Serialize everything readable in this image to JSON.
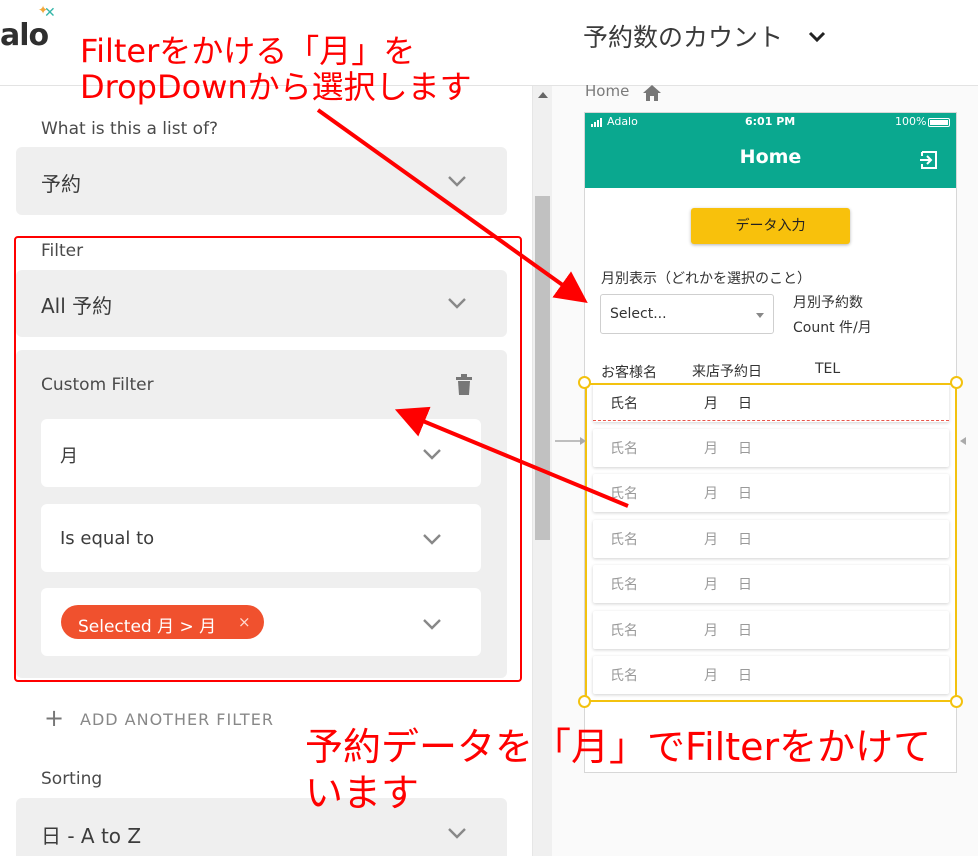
{
  "header": {
    "logo_text": "alo",
    "screen_title": "予約数のカウント"
  },
  "left_panel": {
    "list_of_label": "What is this a list of?",
    "list_of_value": "予約",
    "filter_label": "Filter",
    "filter_value": "All 予約",
    "custom_filter_label": "Custom Filter",
    "field_value": "月",
    "operator_value": "Is equal to",
    "chip_label": "Selected 月 > 月",
    "chip_close": "×",
    "add_filter_label": "ADD ANOTHER FILTER",
    "add_filter_plus": "+",
    "sorting_label": "Sorting",
    "sorting_value": "日 - A to Z"
  },
  "canvas": {
    "breadcrumb": "Home"
  },
  "phone": {
    "status_carrier": "Adalo",
    "status_time": "6:01 PM",
    "status_battery": "100%",
    "title": "Home",
    "data_button": "データ入力",
    "monthly_label": "月別表示（どれかを選択のこと）",
    "dropdown_placeholder": "Select...",
    "count_label_1": "月別予約数",
    "count_label_2": "Count 件/月",
    "columns": [
      "お客様名",
      "来店予約日",
      "TEL"
    ],
    "rows": [
      {
        "name": "氏名",
        "month": "月",
        "day": "日"
      },
      {
        "name": "氏名",
        "month": "月",
        "day": "日"
      },
      {
        "name": "氏名",
        "month": "月",
        "day": "日"
      },
      {
        "name": "氏名",
        "month": "月",
        "day": "日"
      },
      {
        "name": "氏名",
        "month": "月",
        "day": "日"
      },
      {
        "name": "氏名",
        "month": "月",
        "day": "日"
      },
      {
        "name": "氏名",
        "month": "月",
        "day": "日"
      }
    ]
  },
  "annotations": {
    "top_line1": "Filterをかける「月」を",
    "top_line2": "DropDownから選択します",
    "bottom_line1": "予約データを「月」でFilterをかけて",
    "bottom_line2": "います"
  },
  "colors": {
    "teal": "#0aa88f",
    "yellow": "#f8c10c",
    "chip": "#f0512e",
    "annotation": "#ff0000"
  }
}
